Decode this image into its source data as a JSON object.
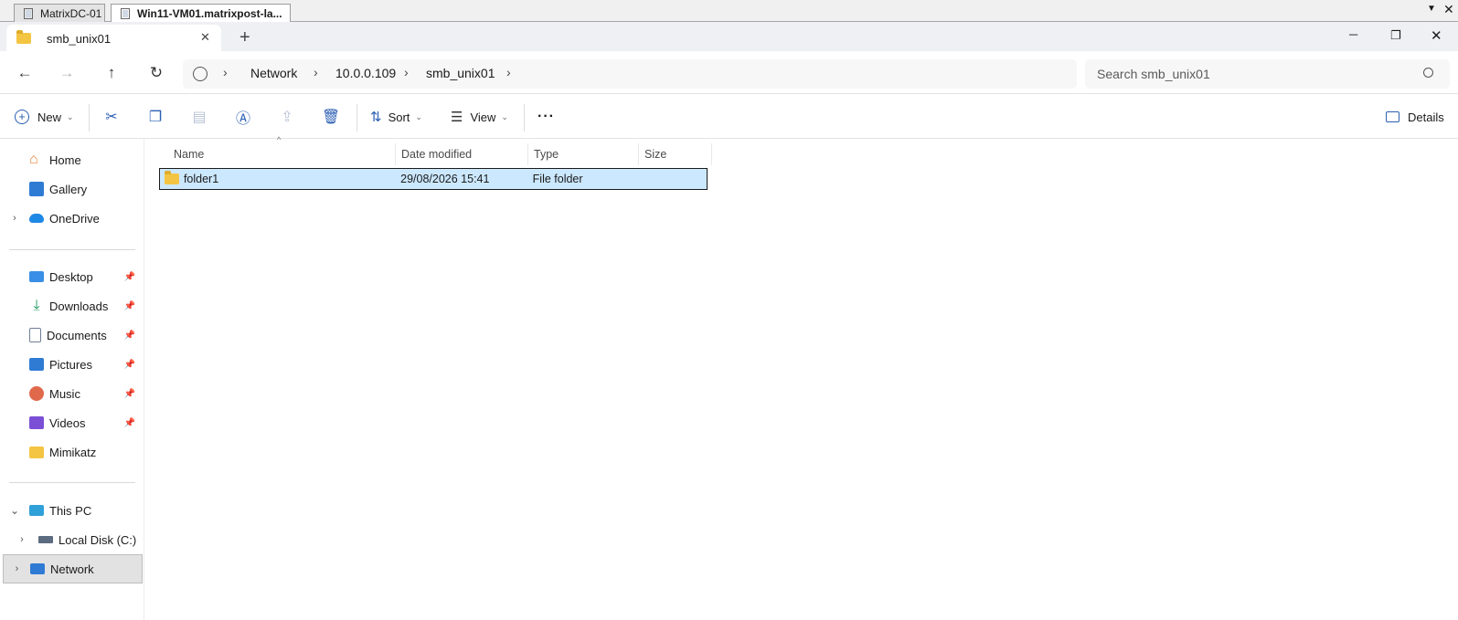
{
  "rdp": {
    "tabs": [
      {
        "label": "MatrixDC-01"
      },
      {
        "label": "Win11-VM01.matrixpost-la..."
      }
    ]
  },
  "explorer_tab": {
    "title": "smb_unix01",
    "close_glyph": "✕",
    "new_tab_glyph": "+"
  },
  "window": {
    "minimize_glyph": "─",
    "maximize_glyph": "❐",
    "close_glyph": "✕"
  },
  "nav": {
    "back_glyph": "←",
    "forward_glyph": "→",
    "up_glyph": "↑",
    "refresh_glyph": "↻"
  },
  "address": {
    "crumbs": [
      "Network",
      "10.0.0.109",
      "smb_unix01"
    ],
    "sep_glyph": "›"
  },
  "search": {
    "placeholder": "Search smb_unix01"
  },
  "toolbar": {
    "new_label": "New",
    "sort_label": "Sort",
    "view_label": "View",
    "more_glyph": "···",
    "details_label": "Details"
  },
  "sidebar": {
    "top": [
      {
        "label": "Home"
      },
      {
        "label": "Gallery"
      },
      {
        "label": "OneDrive"
      }
    ],
    "pinned": [
      {
        "label": "Desktop"
      },
      {
        "label": "Downloads"
      },
      {
        "label": "Documents"
      },
      {
        "label": "Pictures"
      },
      {
        "label": "Music"
      },
      {
        "label": "Videos"
      },
      {
        "label": "Mimikatz"
      }
    ],
    "bottom": [
      {
        "label": "This PC"
      },
      {
        "label": "Local Disk (C:)"
      },
      {
        "label": "Network"
      }
    ]
  },
  "files": {
    "columns": [
      "Name",
      "Date modified",
      "Type",
      "Size"
    ],
    "rows": [
      {
        "name": "folder1",
        "modified": "29/08/2026 15:41",
        "type": "File folder",
        "size": ""
      }
    ]
  },
  "colors": {
    "selection": "#cce8ff",
    "accent": "#2b5fb3"
  }
}
